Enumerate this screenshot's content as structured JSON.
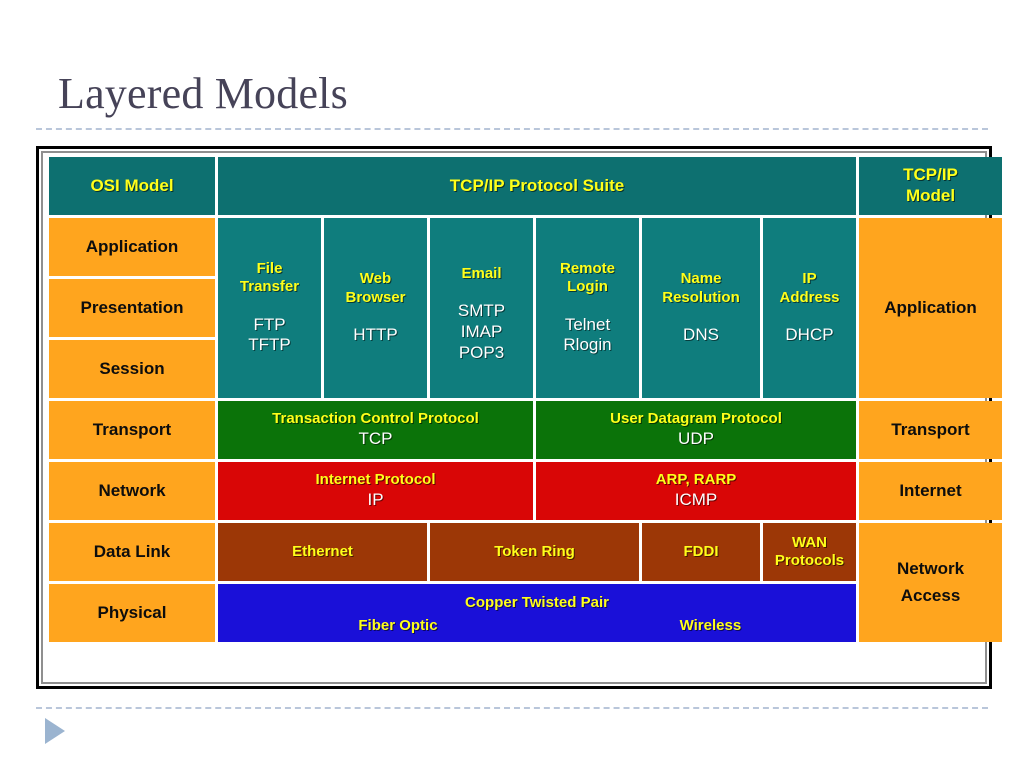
{
  "slide": {
    "title": "Layered Models"
  },
  "table": {
    "header": {
      "osi": "OSI Model",
      "suite": "TCP/IP Protocol Suite",
      "tcpip_model_line1": "TCP/IP",
      "tcpip_model_line2": "Model"
    },
    "osi_layers": [
      "Application",
      "Presentation",
      "Session",
      "Transport",
      "Network",
      "Data Link",
      "Physical"
    ],
    "tcpip_layers": [
      {
        "label": "Application"
      },
      {
        "label": "Transport"
      },
      {
        "label": "Internet"
      },
      {
        "label_line1": "Network",
        "label_line2": "Access"
      }
    ],
    "application_services": [
      {
        "title_line1": "File",
        "title_line2": "Transfer",
        "protocols": [
          "FTP",
          "TFTP"
        ]
      },
      {
        "title_line1": "Web",
        "title_line2": "Browser",
        "protocols": [
          "HTTP"
        ]
      },
      {
        "title_line1": "Email",
        "title_line2": "",
        "protocols": [
          "SMTP",
          "IMAP",
          "POP3"
        ]
      },
      {
        "title_line1": "Remote",
        "title_line2": "Login",
        "protocols": [
          "Telnet",
          "Rlogin"
        ]
      },
      {
        "title_line1": "Name",
        "title_line2": "Resolution",
        "protocols": [
          "DNS"
        ]
      },
      {
        "title_line1": "IP",
        "title_line2": "Address",
        "protocols": [
          "DHCP"
        ]
      }
    ],
    "transport_row": [
      {
        "name": "Transaction Control Protocol",
        "abbr": "TCP"
      },
      {
        "name": "User Datagram Protocol",
        "abbr": "UDP"
      }
    ],
    "network_row": [
      {
        "name": "Internet Protocol",
        "abbr": "IP"
      },
      {
        "name": "ARP, RARP",
        "abbr": "ICMP"
      }
    ],
    "datalink_row": [
      {
        "line1": "Ethernet",
        "line2": ""
      },
      {
        "line1": "Token Ring",
        "line2": ""
      },
      {
        "line1": "FDDI",
        "line2": ""
      },
      {
        "line1": "WAN",
        "line2": "Protocols"
      }
    ],
    "physical_row": {
      "top": "Copper Twisted Pair",
      "left": "Fiber Optic",
      "right": "Wireless"
    }
  },
  "colors": {
    "teal": "#0d7070",
    "orange": "#ffa51e",
    "green": "#0b7309",
    "red": "#d90606",
    "brown": "#9c3706",
    "blue": "#1a10d8",
    "yellow_text": "#ffff1a",
    "title_text": "#464358",
    "rule": "#b9c6da",
    "arrow": "#9bb4d0"
  },
  "navigation": {
    "next_arrow": "play-arrow"
  }
}
